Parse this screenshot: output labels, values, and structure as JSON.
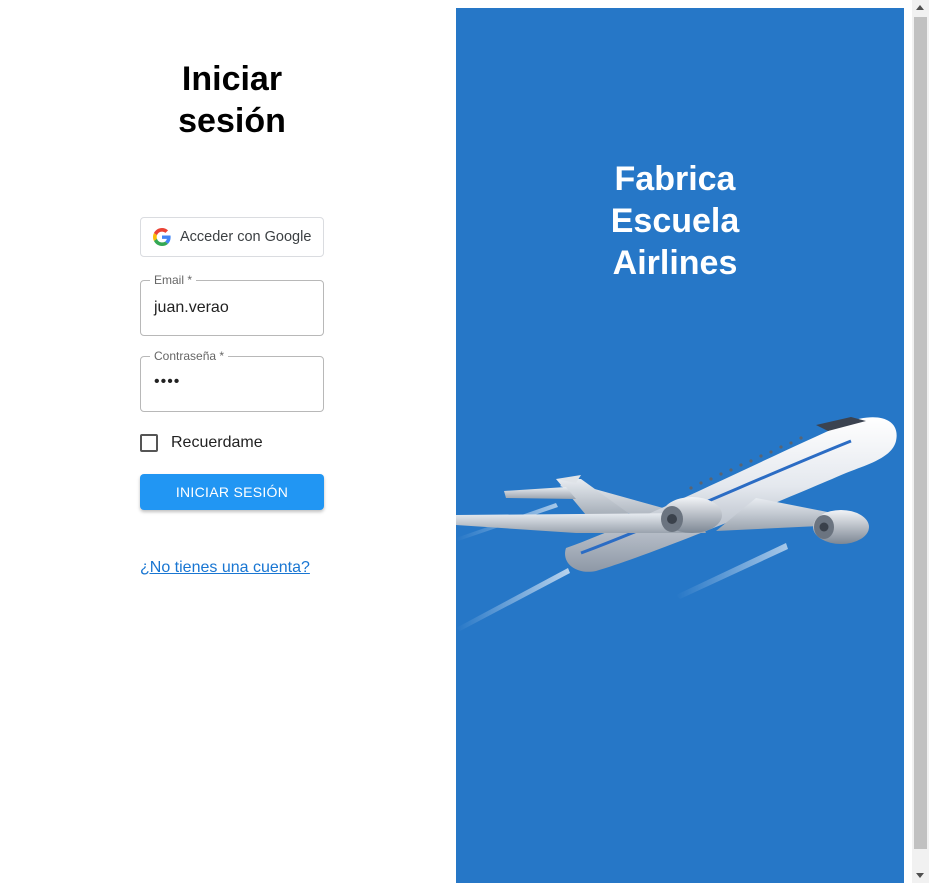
{
  "login": {
    "title_line1": "Iniciar",
    "title_line2": "sesión",
    "google_button_label": "Acceder con Google",
    "email": {
      "label": "Email",
      "required_mark": "*",
      "value": "juan.verao"
    },
    "password": {
      "label": "Contraseña",
      "required_mark": "*",
      "value": "••••"
    },
    "remember_label": "Recuerdame",
    "remember_checked": false,
    "submit_label": "INICIAR SESIÓN",
    "signup_link": "¿No tienes una cuenta?"
  },
  "brand": {
    "line1": "Fabrica",
    "line2": "Escuela",
    "line3": "Airlines",
    "background_color": "#2677c7",
    "illustration": "airplane-illustration"
  },
  "colors": {
    "primary_button": "#2196f3",
    "link": "#1976d2"
  }
}
